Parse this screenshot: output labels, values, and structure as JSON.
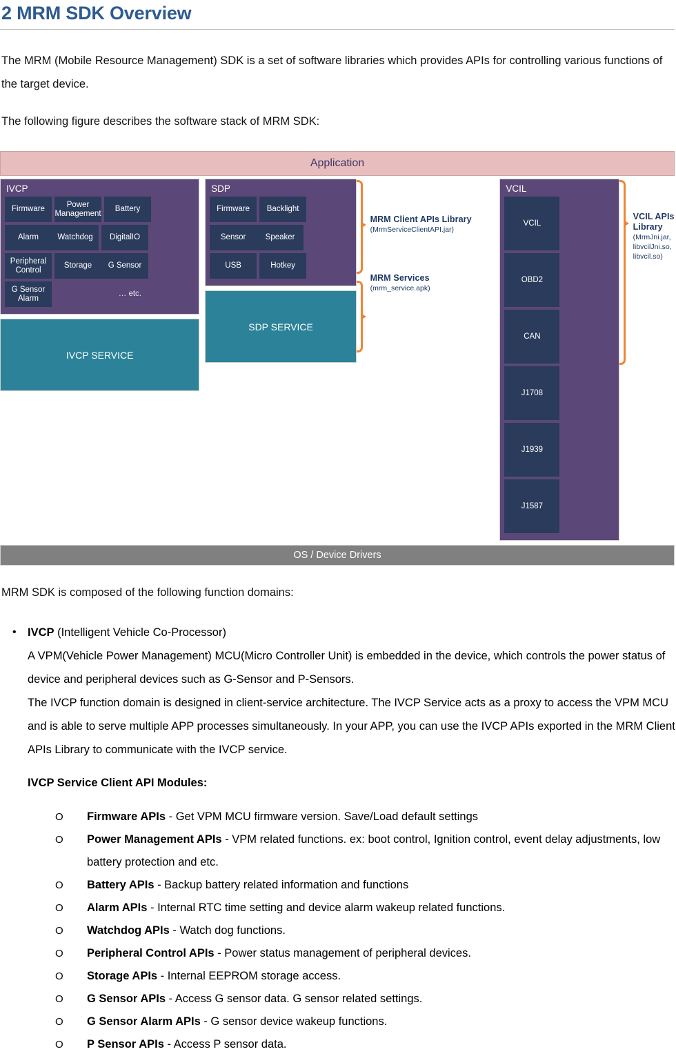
{
  "heading": {
    "text": "2 MRM SDK Overview"
  },
  "intro": {
    "p1": "The MRM (Mobile Resource Management) SDK is a set of software libraries which provides APIs for controlling various functions of the target device.",
    "p2": "The following figure describes the software stack of MRM SDK:"
  },
  "figure": {
    "application_band": "Application",
    "os_band": "OS / Device Drivers",
    "ivcp": {
      "title": "IVCP",
      "tiles": [
        "Firmware",
        "Power Management",
        "Battery",
        "Alarm",
        "Watchdog",
        "DigitalIO",
        "Peripheral Control",
        "Storage",
        "G Sensor",
        "G Sensor Alarm"
      ],
      "etc": "… etc.",
      "service": "IVCP SERVICE"
    },
    "sdp": {
      "title": "SDP",
      "tiles": [
        "Firmware",
        "Backlight",
        "Sensor",
        "Speaker",
        "USB",
        "Hotkey"
      ],
      "service": "SDP SERVICE"
    },
    "vcil": {
      "title": "VCIL",
      "tiles": [
        "VCIL",
        "OBD2",
        "CAN",
        "J1708",
        "J1939",
        "J1587"
      ]
    },
    "labels": {
      "client_api_main": "MRM Client APIs Library",
      "client_api_sub": "(MrmServiceClientAPI.jar)",
      "services_main": "MRM Services",
      "services_sub": "(mrm_service.apk)",
      "vcil_api_main": "VCIL APIs Library",
      "vcil_api_sub": "(MrmJni.jar, libvcilJni.so, libvcil.so)"
    }
  },
  "domains": {
    "lead": "MRM SDK is composed of the following function domains:",
    "bullet_mark": "•",
    "ivcp_title_bold": "IVCP",
    "ivcp_title_rest": " (Intelligent Vehicle Co-Processor)",
    "ivcp_para1": "A VPM(Vehicle Power Management) MCU(Micro Controller Unit) is embedded in the device, which controls the power status of device and peripheral devices such as G-Sensor and P-Sensors.",
    "ivcp_para2": "The IVCP function domain is designed in client-service architecture. The IVCP Service acts as a proxy to access the VPM MCU and is able to serve multiple APP processes simultaneously. In your APP, you can use the IVCP APIs exported in the MRM Client APIs Library to communicate with the IVCP service.",
    "modules_heading": "IVCP Service Client API Modules:"
  },
  "modules": {
    "marker": "O",
    "items": [
      {
        "name": "Firmware APIs",
        "desc": " - Get VPM MCU firmware version. Save/Load default settings"
      },
      {
        "name": "Power Management APIs",
        "desc": " - VPM related functions. ex: boot control, Ignition control, event delay adjustments, low battery protection and etc."
      },
      {
        "name": "Battery APIs",
        "desc": " - Backup battery related information and functions"
      },
      {
        "name": "Alarm APIs",
        "desc": " - Internal RTC time setting and device alarm wakeup related functions."
      },
      {
        "name": "Watchdog APIs",
        "desc": " - Watch dog functions."
      },
      {
        "name": "Peripheral Control APIs",
        "desc": " - Power status management of peripheral devices."
      },
      {
        "name": "Storage APIs",
        "desc": " - Internal EEPROM storage access."
      },
      {
        "name": "G Sensor APIs",
        "desc": " - Access G sensor data. G sensor related settings."
      },
      {
        "name": "G Sensor Alarm APIs",
        "desc": " - G sensor device wakeup functions."
      },
      {
        "name": "P Sensor APIs",
        "desc": " - Access P sensor data."
      }
    ]
  },
  "colors": {
    "heading_blue": "#2e5b8f",
    "application_pink": "#e8bdbd",
    "domain_purple": "#5b4878",
    "tile_navy": "#2a3b5c",
    "service_teal": "#2b8299",
    "os_gray": "#808080",
    "bracket_orange": "#ef8533",
    "label_navy": "#1f3864"
  }
}
